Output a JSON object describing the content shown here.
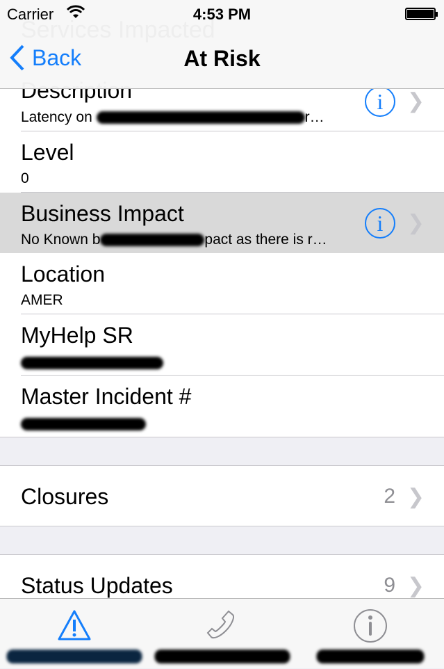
{
  "status": {
    "carrier": "Carrier",
    "time": "4:53 PM"
  },
  "nav": {
    "back": "Back",
    "title": "At Risk",
    "ghost": "Services Impacted"
  },
  "rows": [
    {
      "label": "Description",
      "value": "Latency on",
      "truncated": "r…",
      "info": true,
      "chevron": true
    },
    {
      "label": "Level",
      "value": "0"
    },
    {
      "label": "Business Impact",
      "value": "No Known b",
      "truncated": "pact as there is r…",
      "info": true,
      "chevron": true,
      "highlighted": true
    },
    {
      "label": "Location",
      "value": "AMER"
    },
    {
      "label": "MyHelp SR",
      "value": ""
    },
    {
      "label": "Master Incident #",
      "value": ""
    }
  ],
  "closures": {
    "label": "Closures",
    "count": "2"
  },
  "status_updates": {
    "label": "Status Updates",
    "count": "9"
  },
  "tabs": [
    {
      "icon": "warning-icon",
      "active": true
    },
    {
      "icon": "phone-icon"
    },
    {
      "icon": "info-icon"
    }
  ],
  "colors": {
    "accent": "#147efb",
    "highlight": "#d9d9d9",
    "group_bg": "#efeff4"
  }
}
